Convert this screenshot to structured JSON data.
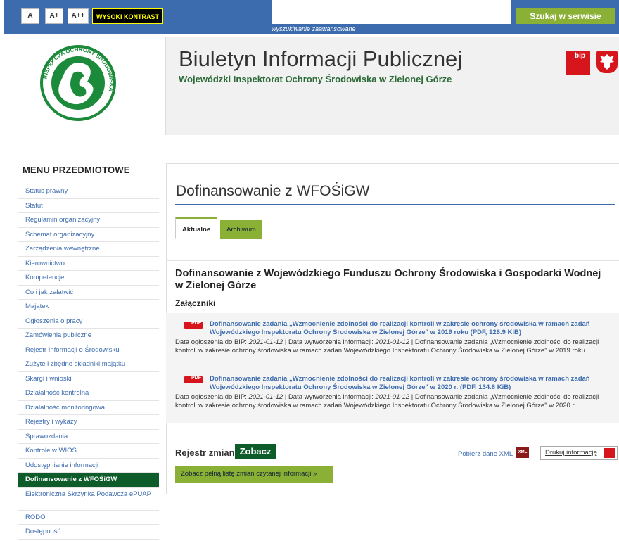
{
  "topbar": {
    "font_a": "A",
    "font_a_plus": "A+",
    "font_a_plus_plus": "A++",
    "contrast": "WYSOKI KONTRAST",
    "advanced_search": "wyszukiwanie zaawansowane",
    "search_button": "Szukaj w serwisie"
  },
  "header": {
    "title": "Biuletyn Informacji Publicznej",
    "subtitle": "Wojewódzki Inspektorat Ochrony Środowiska w Zielonej Górze",
    "logo_text": "INSPEKCJA OCHRONY ŚRODOWISKA",
    "bip_badge": "bip"
  },
  "sidebar": {
    "title": "MENU PRZEDMIOTOWE",
    "items": [
      "Status prawny",
      "Statut",
      "Regulamin organizacyjny",
      "Schemat organizacyjny",
      "Zarządzenia wewnętrzne",
      "Kierownictwo",
      "Kompetencje",
      "Co i jak załatwić",
      "Majątek",
      "Ogłoszenia o pracy",
      "Zamówienia publiczne",
      "Rejestr Informacji o Środowisku",
      "Zużyte i zbędne składniki majątku",
      "Skargi i wnioski",
      "Działalność kontrolna",
      "Działalność monitoringowa",
      "Rejestry i wykazy",
      "Sprawozdania",
      "Kontrole w WIOŚ",
      "Udostępnianie informacji",
      "Dofinansowanie z WFOŚiGW",
      "Elektroniczna Skrzynka Podawcza ePUAP",
      "RODO",
      "Dostępność"
    ]
  },
  "main": {
    "page_title": "Dofinansowanie z WFOŚiGW",
    "tabs": [
      "Aktualne",
      "Archiwum"
    ],
    "section_title": "Dofinansowanie z Wojewódzkiego Funduszu Ochrony Środowiska i Gospodarki Wodnej w Zielonej Górze",
    "attachments_label": "Załączniki",
    "attachments": [
      {
        "link": "Dofinansowanie zadania „Wzmocnienie zdolności do realizacji kontroli w zakresie ochrony środowiska w ramach zadań Wojewódzkiego Inspektoratu Ochrony Środowiska w Zielonej Górze\" w 2019 roku (PDF, 126.9 KiB)",
        "published_label": "Data ogłoszenia do BIP:",
        "published": "2021-01-12",
        "created_label": "Data wytworzenia informacji:",
        "created": "2021-01-12",
        "description": "Dofinansowanie zadania „Wzmocnienie zdolności do realizacji kontroli w zakresie ochrony środowiska w ramach zadań Wojewódzkiego Inspektoratu Ochrony Środowiska w Zielonej Górze\" w 2019 roku"
      },
      {
        "link": "Dofinansowanie zadania „Wzmocnienie zdolności do realizacji kontroli w zakresie ochrony środowiska w ramach zadań Wojewódzkiego Inspektoratu Ochrony Środowiska w Zielonej Górze\" w 2020 r. (PDF, 134.8 KiB)",
        "published_label": "Data ogłoszenia do BIP:",
        "published": "2021-01-12",
        "created_label": "Data wytworzenia informacji:",
        "created": "2021-01-12",
        "description": "Dofinansowanie zadania „Wzmocnienie zdolności do realizacji kontroli w zakresie ochrony środowiska w ramach zadań Wojewódzkiego Inspektoratu Ochrony Środowiska w Zielonej Górze\" w 2020 r."
      }
    ],
    "register_label": "Rejestr zmian",
    "register_button": "Zobacz",
    "xml_link": "Pobierz dane XML",
    "xml_icon": "XML",
    "print_link": "Drukuj informację",
    "full_list_button": "Zobacz pełną listę zmian czytanej informacji »"
  },
  "colors": {
    "topbar_blue": "#3d6cae",
    "accent_green": "#8ab035",
    "dark_green": "#0f5c2b",
    "bip_red": "#d7151d"
  }
}
